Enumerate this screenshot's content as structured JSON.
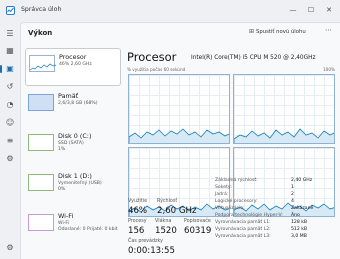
{
  "window": {
    "title": "Správca úloh",
    "controls": {
      "minimize": "—",
      "maximize": "☐",
      "close": "✕"
    }
  },
  "rail": {
    "icons": [
      "menu-icon",
      "processes-icon",
      "performance-icon",
      "history-icon",
      "startup-icon",
      "users-icon",
      "details-icon",
      "services-icon",
      "settings-icon"
    ]
  },
  "header": {
    "title": "Výkon",
    "run_task_label": "Spustiť novú úlohu",
    "more_label": "⋯"
  },
  "resources": [
    {
      "name": "Procesor",
      "sub1": "46% 2,60 GHz",
      "sub2": ""
    },
    {
      "name": "Pamäť",
      "sub1": "2,6/3,8 GB (68%)",
      "sub2": ""
    },
    {
      "name": "Disk 0 (C:)",
      "sub1": "SSD (SATA)",
      "sub2": "1%"
    },
    {
      "name": "Disk 1 (D:)",
      "sub1": "Vymeniteľný (USB)",
      "sub2": "0%"
    },
    {
      "name": "Wi-Fi",
      "sub1": "Wi-Fi",
      "sub2": "Odoslané: 0 Prijaté: 0 kbit"
    }
  ],
  "detail": {
    "title": "Procesor",
    "model": "Intel(R) Core(TM) i5 CPU M 520 @ 2,40GHz",
    "graph_caption": "% využitia počas 60 sekúnd",
    "graph_max": "100%",
    "colors": {
      "graph_line": "#117dbb",
      "graph_fill": "#d7e9f5",
      "grid": "#e6edf5",
      "border": "#8fb1d4"
    }
  },
  "stats": {
    "utilization_label": "Využitie",
    "utilization_value": "46%",
    "speed_label": "Rýchlosť",
    "speed_value": "2,60 GHz",
    "processes_label": "Procesy",
    "processes_value": "156",
    "threads_label": "Vlákna",
    "threads_value": "1520",
    "handles_label": "Popisovače",
    "handles_value": "60319",
    "uptime_label": "Čas prevádzky",
    "uptime_value": "0:00:13:55"
  },
  "specs": [
    {
      "key": "Základná rýchlosť:",
      "value": "2,40 GHz"
    },
    {
      "key": "Sokety:",
      "value": "1"
    },
    {
      "key": "Jadrá:",
      "value": "2"
    },
    {
      "key": "Logické procesory:",
      "value": "4"
    },
    {
      "key": "Virtualizácia:",
      "value": "Zakázané"
    },
    {
      "key": "Podpora technológie Hyper-V:",
      "value": "Áno"
    },
    {
      "key": "Vyrovnávacia pamäť L1:",
      "value": "128 kB"
    },
    {
      "key": "Vyrovnávacia pamäť L2:",
      "value": "512 kB"
    },
    {
      "key": "Vyrovnávacia pamäť L3:",
      "value": "3,0 MB"
    }
  ]
}
